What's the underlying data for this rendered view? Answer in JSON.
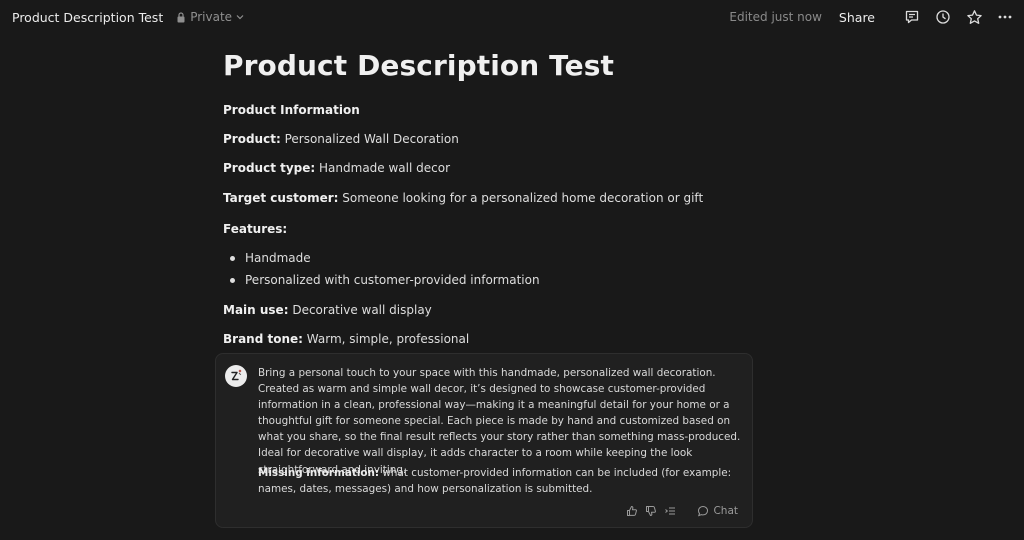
{
  "topbar": {
    "title": "Product Description Test",
    "privacy": "Private",
    "edited": "Edited just now",
    "share_label": "Share",
    "icons": [
      "lock-icon",
      "chevron-down-icon",
      "comment-icon",
      "history-icon",
      "star-icon",
      "more-icon"
    ]
  },
  "doc": {
    "title": "Product Description Test",
    "section_heading": "Product Information",
    "product": {
      "label": "Product:",
      "value": "Personalized Wall Decoration"
    },
    "product_type": {
      "label": "Product type:",
      "value": "Handmade wall decor"
    },
    "target_customer": {
      "label": "Target customer:",
      "value": "Someone looking for a personalized home decoration or gift"
    },
    "features": {
      "label": "Features:",
      "items": [
        "Handmade",
        "Personalized with customer-provided information"
      ]
    },
    "main_use": {
      "label": "Main use:",
      "value": "Decorative wall display"
    },
    "brand_tone": {
      "label": "Brand tone:",
      "value": "Warm, simple, professional"
    }
  },
  "ai_card": {
    "response": "Bring a personal touch to your space with this handmade, personalized wall decoration. Created as warm and simple wall decor, it’s designed to showcase customer-provided information in a clean, professional way—making it a meaningful detail for your home or a thoughtful gift for someone special. Each piece is made by hand and customized based on what you share, so the final result reflects your story rather than something mass-produced. Ideal for decorative wall display, it adds character to a room while keeping the look straightforward and inviting.",
    "missing_label": "Missing information:",
    "missing_text": "what customer-provided information can be included (for example: names, dates, messages) and how personalization is submitted.",
    "chat_label": "Chat",
    "icons": [
      "ai-avatar-icon",
      "thumbs-up-icon",
      "thumbs-down-icon",
      "insert-icon",
      "chat-icon"
    ]
  },
  "colors": {
    "background": "#191919",
    "card": "#202020",
    "text": "#dedede",
    "muted": "#8a8a8a"
  }
}
